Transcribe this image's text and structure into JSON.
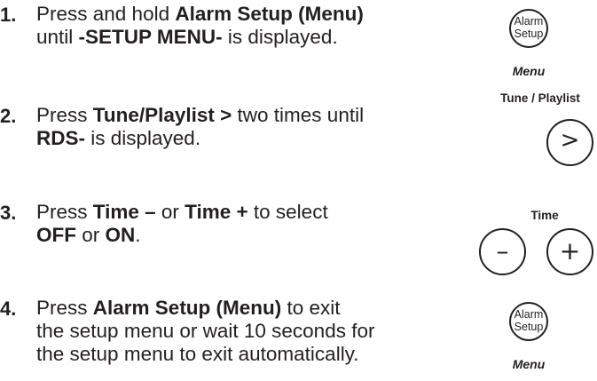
{
  "steps": [
    {
      "number": "1.",
      "line1": [
        "Press and hold ",
        "Alarm Setup (Menu)"
      ],
      "line2": [
        "until ",
        "-SETUP MENU-",
        " is displayed."
      ]
    },
    {
      "number": "2.",
      "line1": [
        "Press ",
        "Tune/Playlist >",
        " two times until"
      ],
      "line2": [
        "RDS-",
        " is displayed."
      ]
    },
    {
      "number": "3.",
      "line1": [
        "Press ",
        "Time –",
        " or ",
        "Time +",
        " to select"
      ],
      "line2": [
        "OFF",
        " or ",
        "ON",
        "."
      ]
    },
    {
      "number": "4.",
      "line1": [
        "Press ",
        "Alarm Setup (Menu)",
        " to exit"
      ],
      "line2": [
        "the setup menu or wait 10 seconds for"
      ],
      "line3": [
        "the setup menu to exit automatically."
      ]
    }
  ],
  "controls": {
    "alarm_setup_1": {
      "line1": "Alarm",
      "line2": "Setup",
      "caption": "Menu"
    },
    "tune_playlist": {
      "label": "Tune / Playlist",
      "symbol": ">"
    },
    "time": {
      "label": "Time",
      "minus": "–",
      "plus": "+"
    },
    "alarm_setup_4": {
      "line1": "Alarm",
      "line2": "Setup",
      "caption": "Menu"
    }
  }
}
